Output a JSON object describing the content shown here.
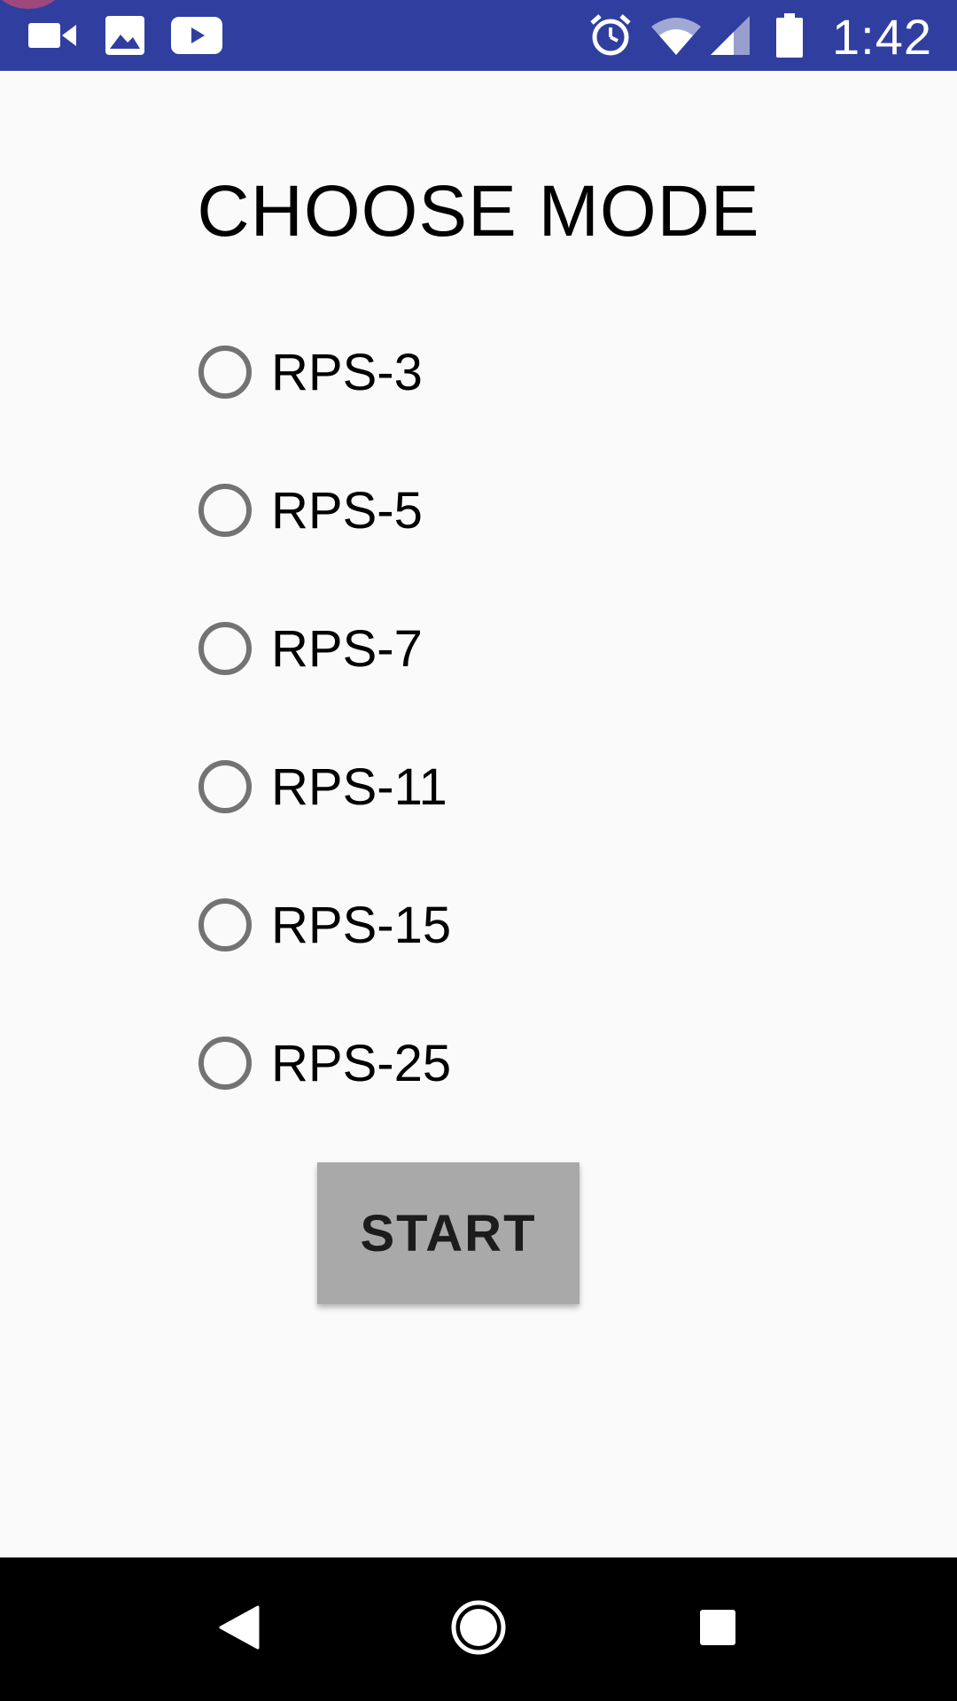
{
  "status_bar": {
    "time": "1:42",
    "background_color": "#303f9f",
    "left_icons": [
      "video-camera-icon",
      "image-icon",
      "youtube-icon"
    ],
    "right_icons": [
      "alarm-icon",
      "wifi-icon",
      "cell-signal-icon",
      "battery-icon"
    ]
  },
  "main": {
    "title": "CHOOSE MODE",
    "options": [
      {
        "label": "RPS-3",
        "selected": false
      },
      {
        "label": "RPS-5",
        "selected": false
      },
      {
        "label": "RPS-7",
        "selected": false
      },
      {
        "label": "RPS-11",
        "selected": false
      },
      {
        "label": "RPS-15",
        "selected": false
      },
      {
        "label": "RPS-25",
        "selected": false
      }
    ],
    "start_label": "START",
    "button_color": "#a9a9a9"
  },
  "nav_bar": {
    "icons": [
      "back-icon",
      "home-icon",
      "recents-icon"
    ]
  }
}
